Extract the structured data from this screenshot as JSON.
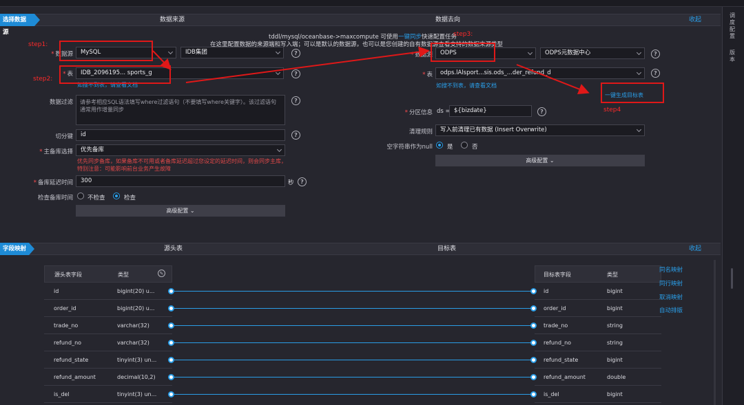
{
  "section1": {
    "tab_label": "选择数据源",
    "source_header": "数据来源",
    "target_header": "数据去向",
    "collapse_label": "收起",
    "info_line1_prefix": "tddl/mysql/oceanbase->maxcompute 可使用",
    "info_line1_link": "一键同步",
    "info_line1_suffix": "快速配置任务",
    "info_line2": "在这里配置数据的来源端和写入端；可以是默认的数据源，也可以是您创建的自有数据源查看支持的数据来源类型"
  },
  "source": {
    "datasource_label": "数据源",
    "datasource_type": "MySQL",
    "datasource_name": "IDB集团",
    "table_label": "表",
    "table_value": "IDB_2096195... sports_g",
    "table_help": "如搜不到表，请查看文档",
    "filter_label": "数据过滤",
    "filter_placeholder": "请参考相应SQL语法填写where过滤语句（不要填写where关键字）。该过滤语句通常用作增量同步",
    "split_label": "切分键",
    "split_value": "id",
    "main_db_label": "主备库选择",
    "main_db_value": "优先备库",
    "main_db_hint": "优先同步备库，如果备库不可用或者备库延迟超过您设定的延迟时间，则会同步主库，特别注意：可能影响前台业务产生故障",
    "delay_label": "备库延迟时间",
    "delay_value": "300",
    "delay_unit": "秒",
    "check_label": "检查备库时间",
    "check_opt_no": "不检查",
    "check_opt_yes": "检查",
    "advanced_label": "高级配置 ⌄"
  },
  "target": {
    "datasource_label": "数据源",
    "datasource_type": "ODPS",
    "datasource_name": "ODPS元数据中心",
    "table_label": "表",
    "table_value": "odps.lAlsport...sis.ods_...der_refund_d",
    "table_help": "如搜不到表，请查看文档",
    "create_table_label": "一键生成目标表",
    "partition_label": "分区信息",
    "partition_key": "ds =",
    "partition_value": "${bizdate}",
    "clean_label": "清理规则",
    "clean_value": "写入前清理已有数据 (Insert Overwrite)",
    "null_label": "空字符串作为null",
    "null_yes": "是",
    "null_no": "否",
    "advanced_label": "高级配置 ⌄"
  },
  "steps": {
    "step1": "step1:",
    "step2": "step2:",
    "step3": "step3:",
    "step4": "step4"
  },
  "section2": {
    "tab_label": "字段映射",
    "source_header": "源头表",
    "target_header": "目标表",
    "collapse_label": "收起",
    "src_col_field": "源头表字段",
    "src_col_type": "类型",
    "tgt_col_field": "目标表字段",
    "tgt_col_type": "类型",
    "actions": [
      "同名映射",
      "同行映射",
      "取消映射",
      "自动排版"
    ]
  },
  "mapping_rows": [
    {
      "src": "id",
      "src_type": "bigint(20) u...",
      "tgt": "id",
      "tgt_type": "bigint"
    },
    {
      "src": "order_id",
      "src_type": "bigint(20) u...",
      "tgt": "order_id",
      "tgt_type": "bigint"
    },
    {
      "src": "trade_no",
      "src_type": "varchar(32)",
      "tgt": "trade_no",
      "tgt_type": "string"
    },
    {
      "src": "refund_no",
      "src_type": "varchar(32)",
      "tgt": "refund_no",
      "tgt_type": "string"
    },
    {
      "src": "refund_state",
      "src_type": "tinyint(3) un...",
      "tgt": "refund_state",
      "tgt_type": "bigint"
    },
    {
      "src": "refund_amount",
      "src_type": "decimal(10,2)",
      "tgt": "refund_amount",
      "tgt_type": "double"
    },
    {
      "src": "is_del",
      "src_type": "tinyint(3) un...",
      "tgt": "is_del",
      "tgt_type": "bigint"
    }
  ],
  "right_panel": {
    "text1": "调度配置",
    "text2": "版本"
  }
}
